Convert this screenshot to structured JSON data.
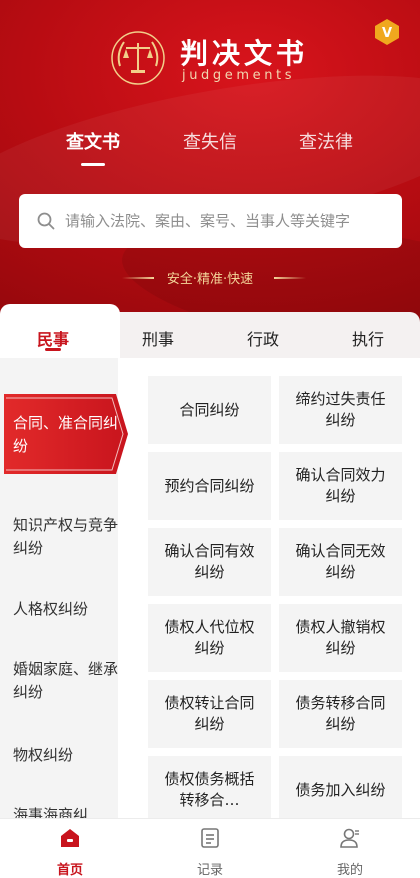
{
  "header": {
    "title": "判决文书",
    "subtitle": "judgements",
    "vip_badge": "V",
    "tabs": [
      {
        "label": "查文书",
        "active": true
      },
      {
        "label": "查失信",
        "active": false
      },
      {
        "label": "查法律",
        "active": false
      }
    ],
    "search": {
      "placeholder": "请输入法院、案由、案号、当事人等关键字",
      "value": "",
      "icon": "search-icon"
    },
    "tagline": "安全·精准·快速"
  },
  "categories": {
    "tabs": [
      {
        "label": "民事",
        "active": true
      },
      {
        "label": "刑事",
        "active": false
      },
      {
        "label": "行政",
        "active": false
      },
      {
        "label": "执行",
        "active": false
      }
    ]
  },
  "sidebar": {
    "active": "合同、准合同纠纷",
    "items": [
      "合同、准合同纠纷",
      "知识产权与竞争纠纷",
      "人格权纠纷",
      "婚姻家庭、继承纠纷",
      "物权纠纷",
      "海事海商纠"
    ]
  },
  "grid": {
    "items": [
      "合同纠纷",
      "缔约过失责任纠纷",
      "预约合同纠纷",
      "确认合同效力纠纷",
      "确认合同有效纠纷",
      "确认合同无效纠纷",
      "债权人代位权纠纷",
      "债权人撤销权纠纷",
      "债权转让合同纠纷",
      "债务转移合同纠纷",
      "债权债务概括转移合…",
      "债务加入纠纷"
    ]
  },
  "bottom_nav": {
    "items": [
      {
        "label": "首页",
        "icon": "home-icon",
        "active": true
      },
      {
        "label": "记录",
        "icon": "record-icon",
        "active": false
      },
      {
        "label": "我的",
        "icon": "profile-icon",
        "active": false
      }
    ]
  },
  "colors": {
    "brand_red": "#c8141d",
    "header_red": "#b80c12",
    "gold": "#f4d69a",
    "vip_gold": "#f0a81e"
  }
}
